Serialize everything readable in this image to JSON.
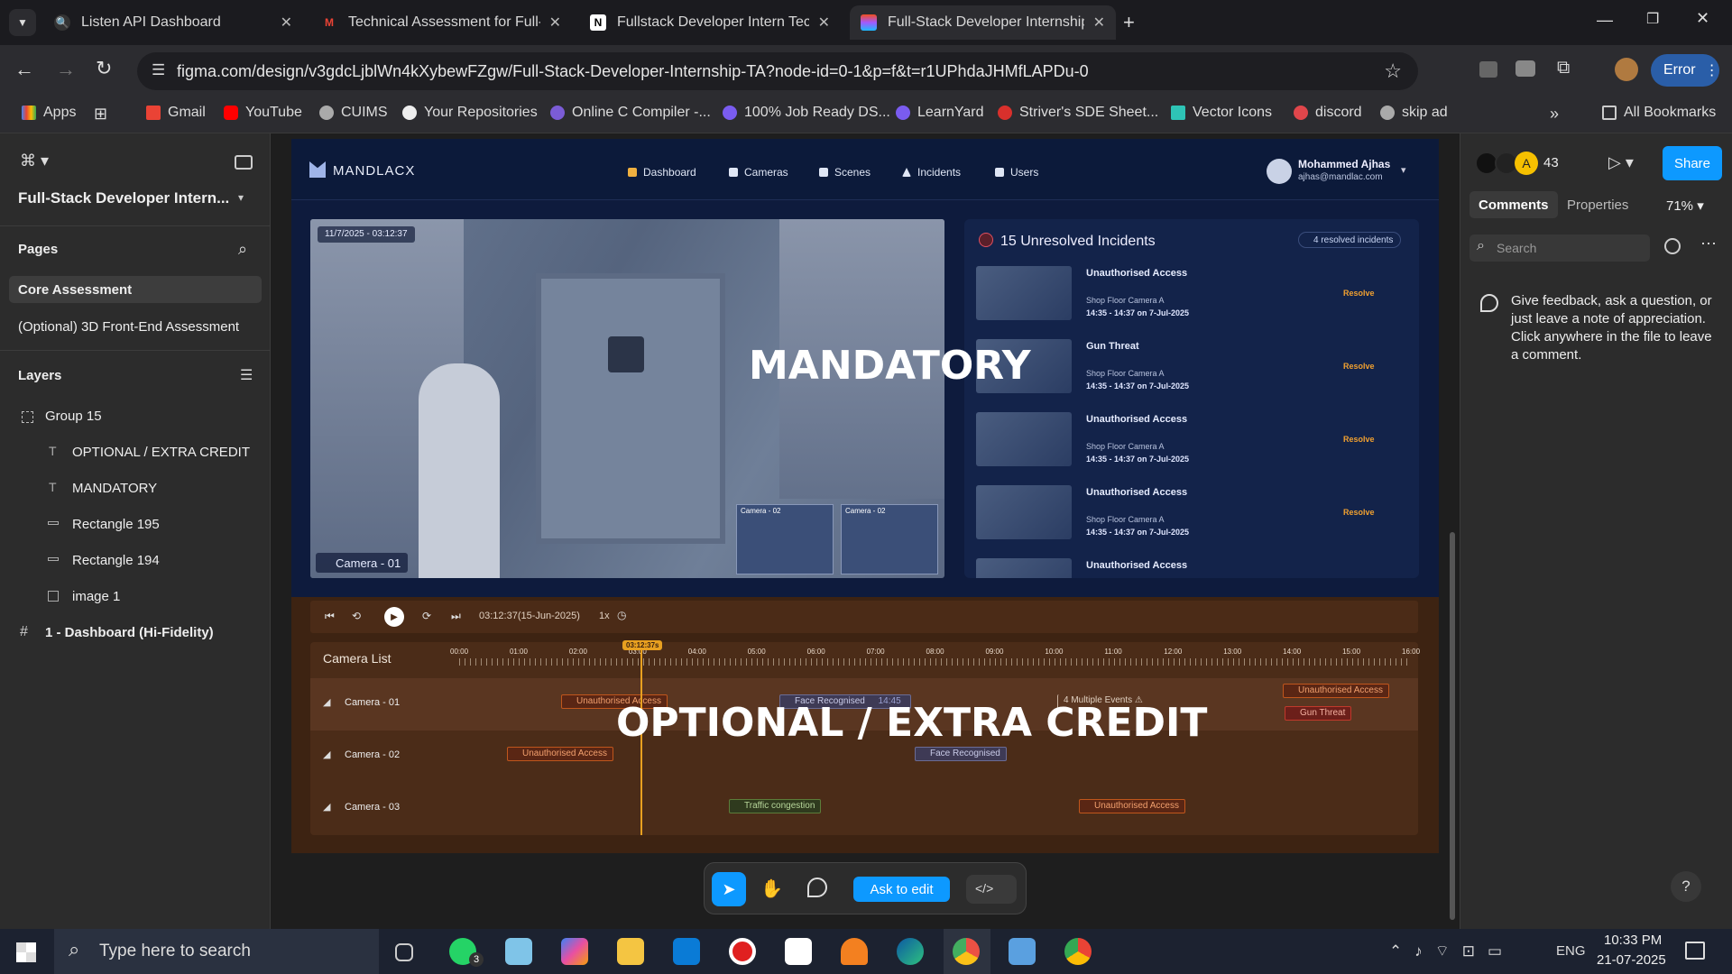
{
  "browser": {
    "tabs": [
      {
        "title": "Listen API Dashboard",
        "fav": "listen-icon",
        "color": "#c0392b"
      },
      {
        "title": "Technical Assessment for Full-St",
        "fav": "gmail-icon",
        "color": "#ea4335"
      },
      {
        "title": "Fullstack Developer Intern Techn",
        "fav": "notion-icon",
        "color": "#ffffff"
      },
      {
        "title": "Full-Stack Developer Internship",
        "fav": "figma-icon",
        "color": "#a259ff"
      }
    ],
    "url": "figma.com/design/v3gdcLjblWn4kXybewFZgw/Full-Stack-Developer-Internship-TA?node-id=0-1&p=f&t=r1UPhdaJHMfLAPDu-0",
    "error_label": "Error",
    "bookmarks": [
      "Apps",
      "Gmail",
      "YouTube",
      "CUIMS",
      "Your Repositories",
      "Online C Compiler -...",
      "100% Job Ready DS...",
      "LearnYard",
      "Striver's SDE Sheet...",
      "Vector Icons",
      "discord",
      "skip ad"
    ],
    "all_bookmarks": "All Bookmarks"
  },
  "figma": {
    "file_name": "Full-Stack Developer Intern...",
    "pages_label": "Pages",
    "pages": [
      "Core Assessment",
      "(Optional) 3D Front-End Assessment"
    ],
    "layers_label": "Layers",
    "layers": [
      {
        "name": "Group 15",
        "icon": "group-icon"
      },
      {
        "name": "OPTIONAL / EXTRA CREDIT",
        "icon": "text-icon"
      },
      {
        "name": "MANDATORY",
        "icon": "text-icon"
      },
      {
        "name": "Rectangle 195",
        "icon": "rectangle-icon"
      },
      {
        "name": "Rectangle 194",
        "icon": "rectangle-icon"
      },
      {
        "name": "image 1",
        "icon": "image-icon"
      },
      {
        "name": "1 - Dashboard (Hi-Fidelity)",
        "icon": "frame-icon"
      }
    ],
    "right": {
      "avatar_letter": "A",
      "user_count": "43",
      "share_label": "Share",
      "tabs": [
        "Comments",
        "Properties"
      ],
      "zoom": "71%",
      "search_placeholder": "Search",
      "comment_hint": "Give feedback, ask a question, or just leave a note of appreciation. Click anywhere in the file to leave a comment."
    },
    "toolbar": {
      "ask_label": "Ask to edit"
    }
  },
  "design": {
    "brand": "MANDLACX",
    "nav": [
      "Dashboard",
      "Cameras",
      "Scenes",
      "Incidents",
      "Users"
    ],
    "user_name": "Mohammed Ajhas",
    "user_email": "ajhas@mandlac.com",
    "video_timestamp": "11/7/2025 - 03:12:37",
    "camera_label": "Camera - 01",
    "mini_cams": [
      "Camera - 02",
      "Camera - 02"
    ],
    "incidents_title": "15 Unresolved Incidents",
    "resolved_label": "4 resolved incidents",
    "incidents": [
      {
        "type": "Unauthorised Access",
        "cam": "Shop Floor Camera A",
        "time": "14:35 - 14:37 on 7-Jul-2025",
        "action": "Resolve"
      },
      {
        "type": "Gun Threat",
        "cam": "Shop Floor Camera A",
        "time": "14:35 - 14:37 on 7-Jul-2025",
        "action": "Resolve"
      },
      {
        "type": "Unauthorised Access",
        "cam": "Shop Floor Camera A",
        "time": "14:35 - 14:37 on 7-Jul-2025",
        "action": "Resolve"
      },
      {
        "type": "Unauthorised Access",
        "cam": "Shop Floor Camera A",
        "time": "14:35 - 14:37 on 7-Jul-2025",
        "action": "Resolve"
      },
      {
        "type": "Unauthorised Access",
        "cam": "",
        "time": "",
        "action": ""
      }
    ],
    "playback_time": "03:12:37(15-Jun-2025)",
    "speed": "1x",
    "camera_list_label": "Camera List",
    "playhead": "03:12:37s",
    "hours": [
      "00:00",
      "01:00",
      "02:00",
      "03:00",
      "04:00",
      "05:00",
      "06:00",
      "07:00",
      "08:00",
      "09:00",
      "10:00",
      "11:00",
      "12:00",
      "13:00",
      "14:00",
      "15:00",
      "16:00"
    ],
    "cameras": [
      "Camera - 01",
      "Camera - 02",
      "Camera - 03"
    ],
    "events": {
      "cam1": [
        "Unauthorised Access",
        "Face Recognised",
        "14:45",
        "4 Multiple Events",
        "Unauthorised Access",
        "Gun Threat"
      ],
      "cam2": [
        "Unauthorised Access",
        "Face Recognised"
      ],
      "cam3": [
        "Traffic congestion",
        "Unauthorised Access"
      ]
    },
    "overlay_mandatory": "MANDATORY",
    "overlay_optional": "OPTIONAL / EXTRA CREDIT"
  },
  "taskbar": {
    "search_placeholder": "Type here to search",
    "whatsapp_badge": "3",
    "lang": "ENG",
    "time": "10:33 PM",
    "date": "21-07-2025"
  }
}
